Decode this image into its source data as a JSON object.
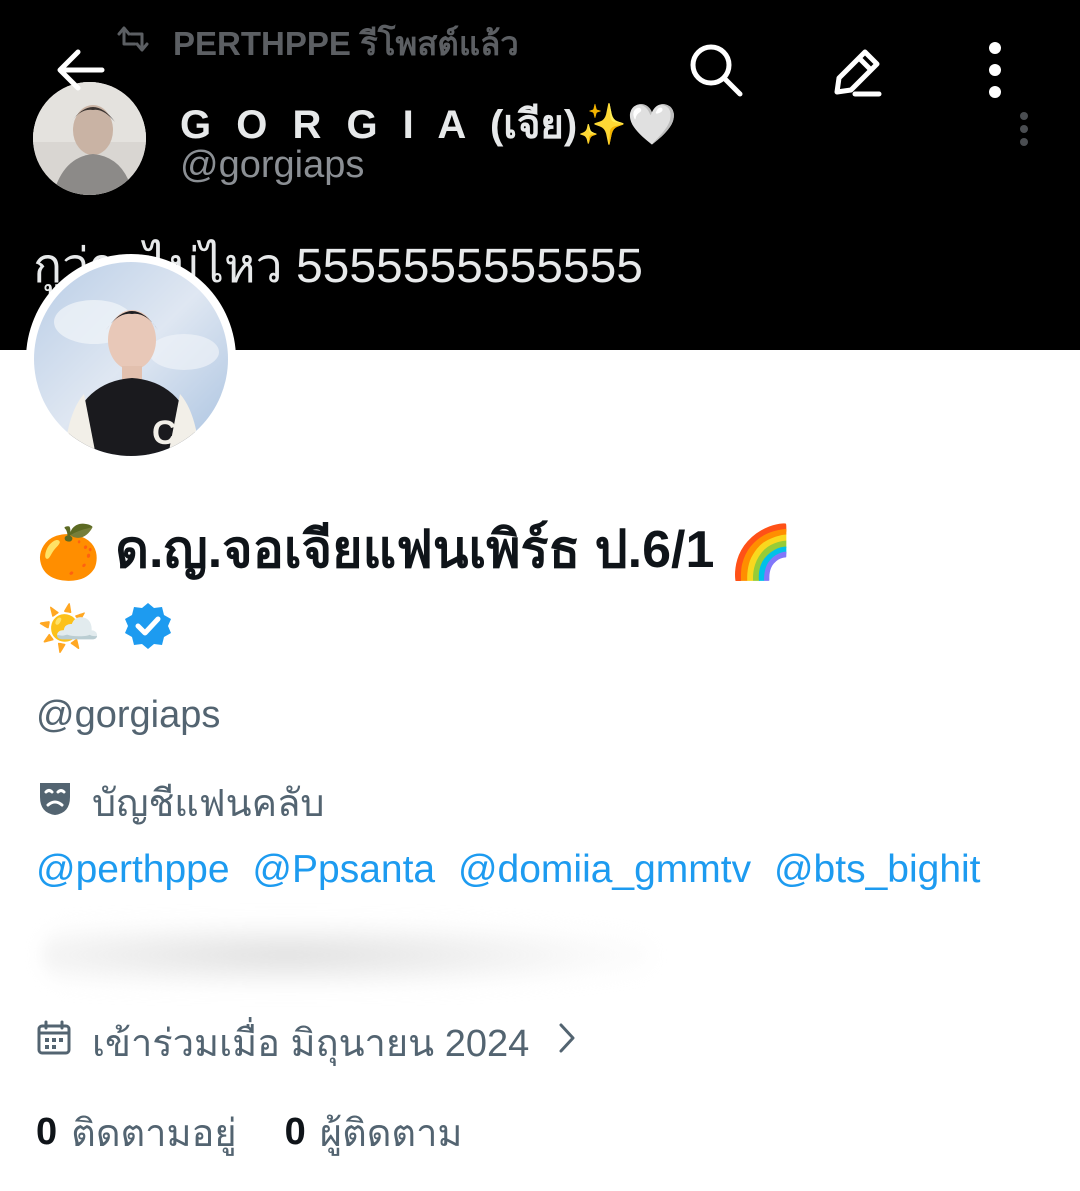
{
  "banner": {
    "retweet_label": "PERTHPPE รีโพสต์แล้ว",
    "quoted": {
      "name": "G O R G I A",
      "name_suffix": "(เจีย)✨🤍",
      "handle": "@gorgiaps",
      "text": "กูว่าจไม่ไหว 5555555555555"
    }
  },
  "icons": {
    "back": "back-arrow-icon",
    "search": "search-icon",
    "edit": "pencil-icon",
    "more": "more-vertical-icon"
  },
  "profile": {
    "name_prefix_emoji": "🍊",
    "name": "ด.ญ.จอเจียแฟนเพิร์ธ ป.6/1",
    "name_suffix_emoji": "🌈",
    "name_line2_emoji": "🌤️",
    "handle": "@gorgiaps",
    "account_label": "บัญชีแฟนคลับ",
    "bio_mentions": [
      "@perthppe",
      "@Ppsanta",
      "@domiia_gmmtv",
      "@bts_bighit"
    ],
    "joined": "เข้าร่วมเมื่อ มิถุนายน 2024",
    "following_count": "0",
    "following_label": "ติดตามอยู่",
    "followers_count": "0",
    "followers_label": "ผู้ติดตาม"
  },
  "colors": {
    "banner_bg": "#000000",
    "link": "#1d9bf0",
    "secondary_text": "#536471",
    "primary_text": "#0f1419",
    "verified": "#1d9bf0"
  }
}
